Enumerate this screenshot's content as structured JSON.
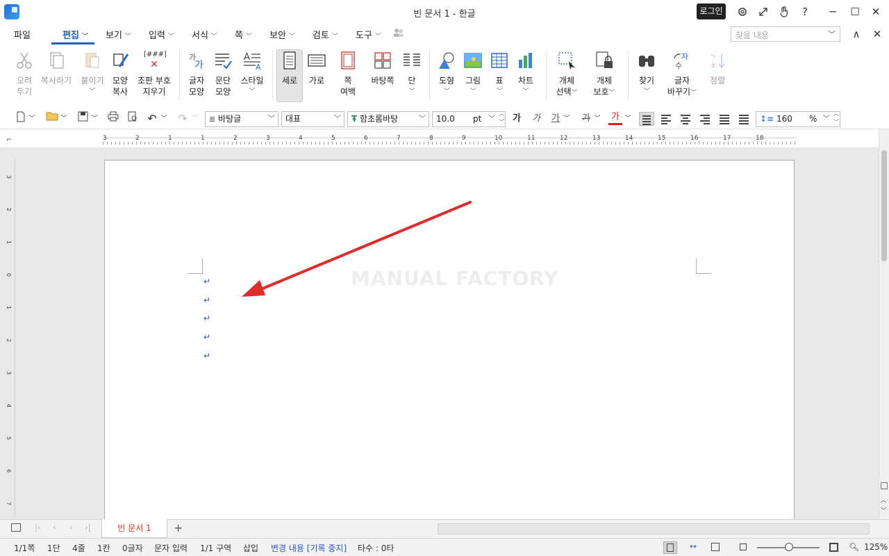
{
  "window": {
    "title": "빈 문서 1 - 한글",
    "login_label": "로그인",
    "settings_icon": "gear-icon",
    "fullscreen_icon": "expand-icon",
    "touch_icon": "hand-icon",
    "help_label": "?",
    "minimize_label": "─",
    "maximize_label": "☐",
    "close_label": "✕"
  },
  "menu": {
    "file": "파일",
    "edit": "편집",
    "view": "보기",
    "insert": "입력",
    "format": "서식",
    "page": "쪽",
    "security": "보안",
    "review": "검토",
    "tools": "도구",
    "search_placeholder": "찾을 내용",
    "collapse_label": "∧",
    "close_label": "✕"
  },
  "ribbon": {
    "cut": [
      "오려",
      "두기"
    ],
    "copy": "복사하기",
    "paste": "붙이기",
    "format_copy": [
      "모양",
      "복사"
    ],
    "erase_marks": [
      "조판 부호",
      "지우기"
    ],
    "char_shape": [
      "글자",
      "모양"
    ],
    "para_shape": [
      "문단",
      "모양"
    ],
    "style": "스타일",
    "portrait": "세로",
    "landscape": "가로",
    "page_margin": [
      "쪽",
      "여백"
    ],
    "master_page": "바탕쪽",
    "column": "단",
    "shape": "도형",
    "picture": "그림",
    "table": "표",
    "chart": "차트",
    "object_select": [
      "개체",
      "선택"
    ],
    "object_protect": [
      "개체",
      "보호"
    ],
    "find": "찾기",
    "replace": [
      "글자",
      "바꾸기"
    ],
    "sort": "정렬",
    "erase_marks_icon_text": "[###]"
  },
  "format_bar": {
    "style": "바탕글",
    "lang": "대표",
    "font": "함초롬바탕",
    "font_size": "10.0",
    "size_unit": "pt",
    "bold_glyph": "가",
    "italic_glyph": "가",
    "underline_glyph": "가",
    "strike_glyph": "가",
    "color_glyph": "가",
    "line_spacing": "160",
    "spacing_unit": "%"
  },
  "ruler": {
    "h_numbers": [
      "3",
      "2",
      "1",
      "1",
      "2",
      "3",
      "4",
      "5",
      "6",
      "7",
      "8",
      "9",
      "10",
      "11",
      "12",
      "13",
      "14",
      "15",
      "16",
      "17",
      "18"
    ],
    "v_numbers": [
      "3",
      "2",
      "1",
      "0",
      "1",
      "2",
      "3",
      "4",
      "5",
      "6",
      "7"
    ]
  },
  "document": {
    "watermark": "MANUAL FACTORY",
    "paragraph_marks": [
      "↵",
      "↵",
      "↵",
      "↵",
      "↵"
    ],
    "annotation_arrow_color": "#e02b2b"
  },
  "tabs": {
    "doc_tab": "빈 문서 1",
    "add_label": "+"
  },
  "status": {
    "page": "1/1쪽",
    "column": "1단",
    "line": "4줄",
    "col": "1칸",
    "chars": "0글자",
    "mode": "문자 입력",
    "section": "1/1 구역",
    "insert": "삽입",
    "track": "변경 내용 [기록 중지]",
    "typing": "타수 : 0타",
    "zoom": "125%"
  },
  "colors": {
    "accent": "#1c5fbf",
    "tab_text": "#d9331c",
    "para_mark": "#2b55c7"
  }
}
